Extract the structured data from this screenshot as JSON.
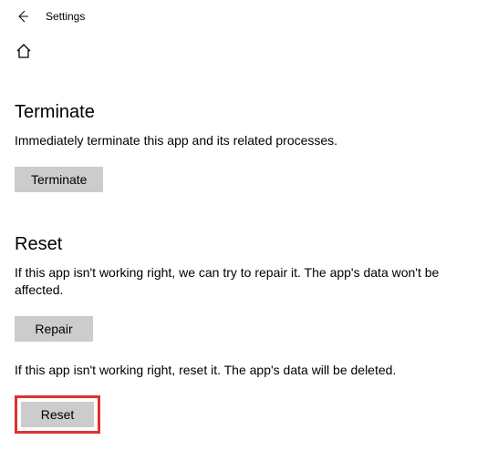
{
  "header": {
    "title": "Settings"
  },
  "sections": {
    "terminate": {
      "title": "Terminate",
      "desc": "Immediately terminate this app and its related processes.",
      "button": "Terminate"
    },
    "reset": {
      "title": "Reset",
      "repair_desc": "If this app isn't working right, we can try to repair it. The app's data won't be affected.",
      "repair_button": "Repair",
      "reset_desc": "If this app isn't working right, reset it. The app's data will be deleted.",
      "reset_button": "Reset"
    }
  }
}
